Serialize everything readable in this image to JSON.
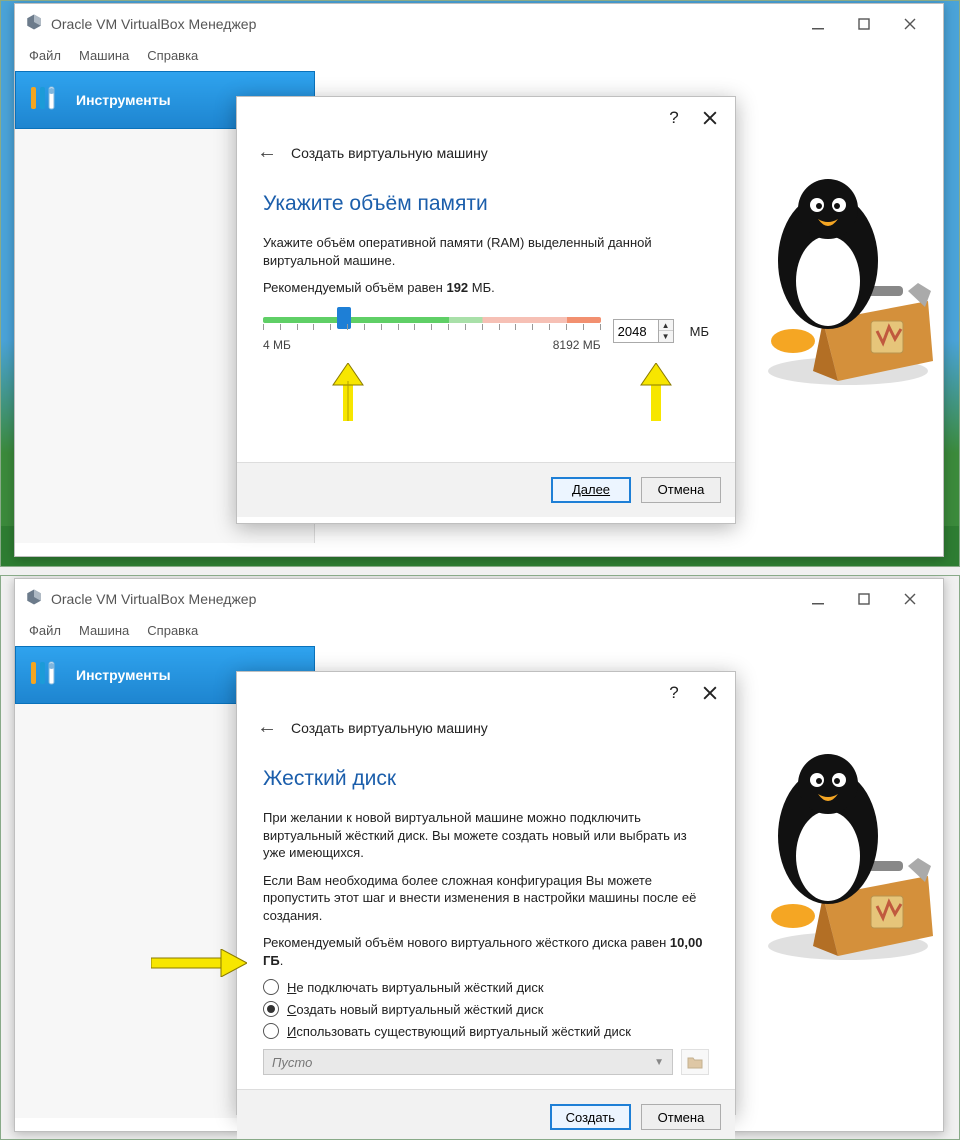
{
  "shared": {
    "window_title": "Oracle VM VirtualBox Менеджер",
    "menu": {
      "file": "Файл",
      "machine": "Машина",
      "help": "Справка"
    },
    "tools_label": "Инструменты"
  },
  "dlg_common": {
    "header": "Создать виртуальную машину"
  },
  "memory": {
    "heading": "Укажите объём памяти",
    "desc": "Укажите объём оперативной памяти (RAM) выделенный данной виртуальной машине.",
    "rec_prefix": "Рекомендуемый объём равен ",
    "rec_value": "192",
    "rec_suffix": " МБ.",
    "min_label": "4 МБ",
    "max_label": "8192 МБ",
    "value": "2048",
    "unit": "МБ",
    "btn_next": "Далее",
    "btn_cancel": "Отмена",
    "handle_pct": 24
  },
  "disk": {
    "heading": "Жесткий диск",
    "p1": "При желании к новой виртуальной машине можно подключить виртуальный жёсткий диск. Вы можете создать новый или выбрать из уже имеющихся.",
    "p2": "Если Вам необходима более сложная конфигурация Вы можете пропустить этот шаг и внести изменения в настройки машины после её создания.",
    "rec_prefix": "Рекомендуемый объём нового виртуального жёсткого диска равен ",
    "rec_value": "10,00 ГБ",
    "rec_suffix": ".",
    "opt_none": "Не подключать виртуальный жёсткий диск",
    "opt_create": "Создать новый виртуальный жёсткий диск",
    "opt_existing": "Использовать существующий виртуальный жёсткий диск",
    "dropdown_value": "Пусто",
    "btn_create": "Создать",
    "btn_cancel": "Отмена"
  }
}
